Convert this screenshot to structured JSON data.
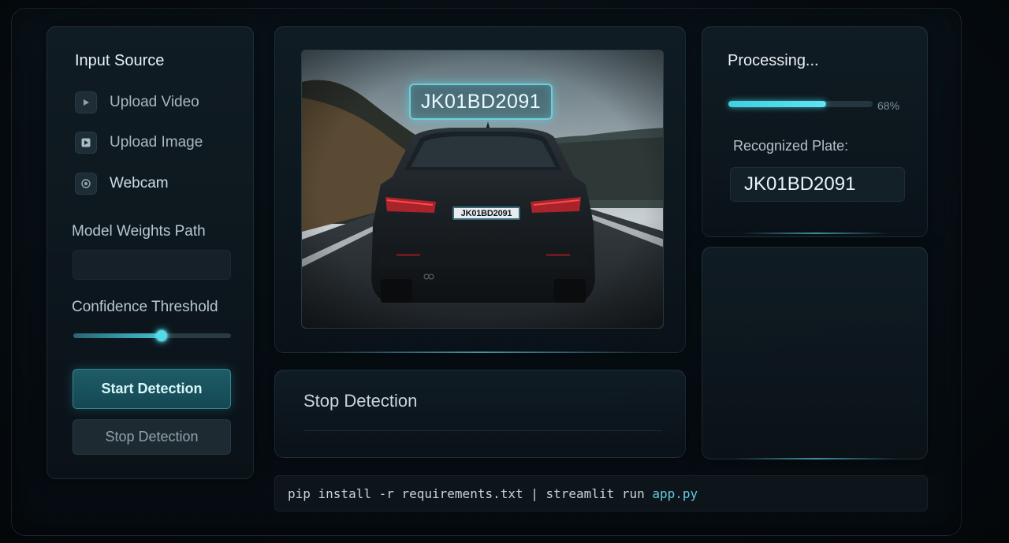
{
  "input_source": {
    "title": "Input Source",
    "options": [
      {
        "label": "Upload Video",
        "icon": "play-icon"
      },
      {
        "label": "Upload Image",
        "icon": "image-play-icon"
      },
      {
        "label": "Webcam",
        "icon": "webcam-icon"
      }
    ]
  },
  "model_weights": {
    "label": "Model Weights Path",
    "value": ""
  },
  "confidence": {
    "label": "Confidence Threshold",
    "value": 0.56
  },
  "buttons": {
    "start": "Start Detection",
    "stop": "Stop Detection"
  },
  "preview": {
    "detected_plate_label": "JK01BD2091",
    "car_plate_text": "JK01BD2091"
  },
  "stop_panel": {
    "title": "Stop Detection"
  },
  "processing": {
    "title": "Processing...",
    "progress_percent": 68,
    "progress_text": "68%",
    "recognized_label": "Recognized Plate:",
    "recognized_value": "JK01BD2091"
  },
  "command": {
    "text": "pip install -r requirements.txt | streamlit run ",
    "app": "app.py"
  },
  "colors": {
    "accent": "#3ed0e2",
    "start_button": "#1e5c66",
    "background": "#060b10"
  }
}
